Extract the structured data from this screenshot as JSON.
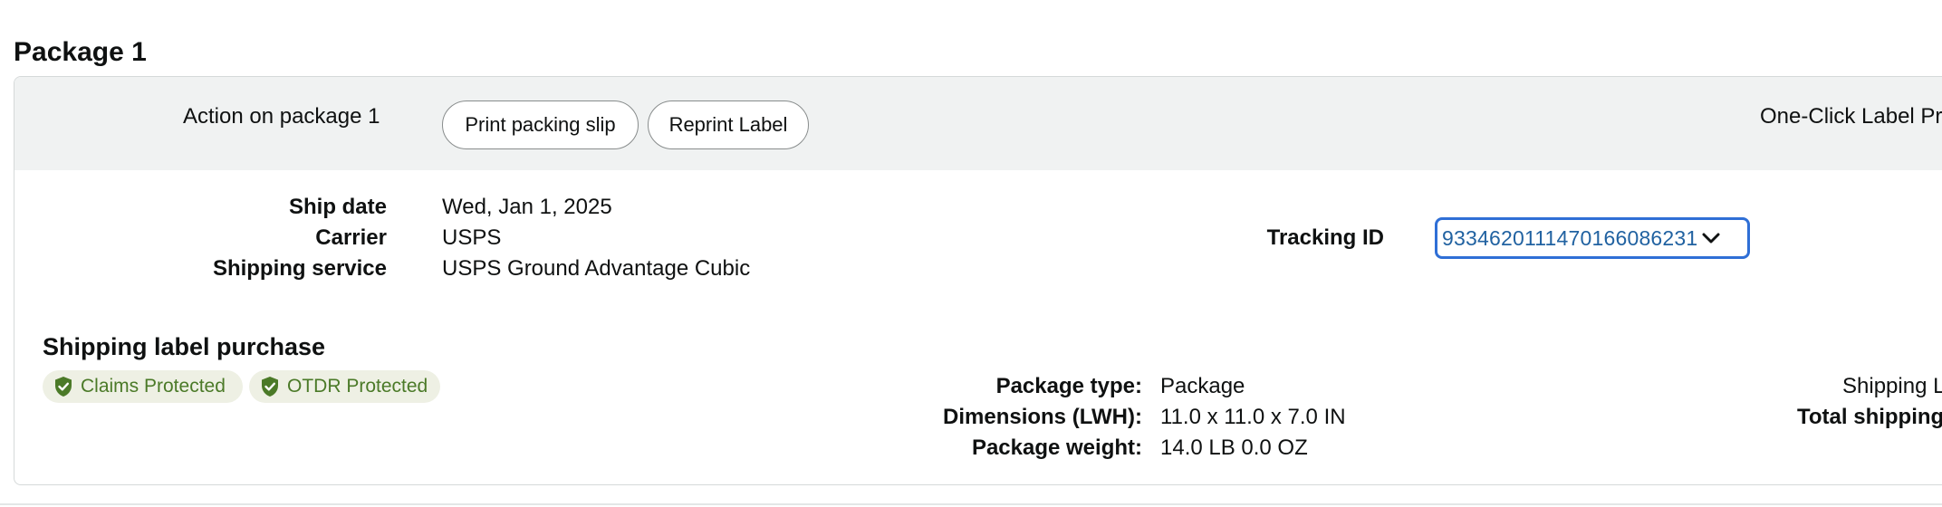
{
  "page": {
    "heading": "Package 1"
  },
  "action_bar": {
    "label": "Action on package 1",
    "print_packing_slip": "Print packing slip",
    "reprint_label": "Reprint Label",
    "one_click_label": "One-Click Label Pri"
  },
  "shipment": {
    "ship_date_label": "Ship date",
    "ship_date_value": "Wed, Jan 1, 2025",
    "carrier_label": "Carrier",
    "carrier_value": "USPS",
    "service_label": "Shipping service",
    "service_value": "USPS Ground Advantage Cubic",
    "tracking_label": "Tracking ID",
    "tracking_value": "9334620111470166086231",
    "tracking_icon": "chevron-down-icon"
  },
  "label_purchase": {
    "title": "Shipping label purchase",
    "badges": [
      {
        "label": "Claims Protected",
        "icon": "shield-check-icon"
      },
      {
        "label": "OTDR Protected",
        "icon": "shield-check-icon"
      }
    ],
    "package_type_label": "Package type:",
    "package_type_value": "Package",
    "dimensions_label": "Dimensions (LWH):",
    "dimensions_value": "11.0 x 11.0 x 7.0 IN",
    "weight_label": "Package weight:",
    "weight_value": "14.0 LB 0.0 OZ",
    "shipping_label_cut": "Shipping L",
    "total_shipping_cut": "Total shipping"
  },
  "colors": {
    "accent_link": "#2162a1",
    "focus_ring": "#2f6fd6",
    "badge_green": "#4b7a28",
    "badge_bg": "#eef0e4",
    "action_bar_bg": "#f0f2f2"
  }
}
